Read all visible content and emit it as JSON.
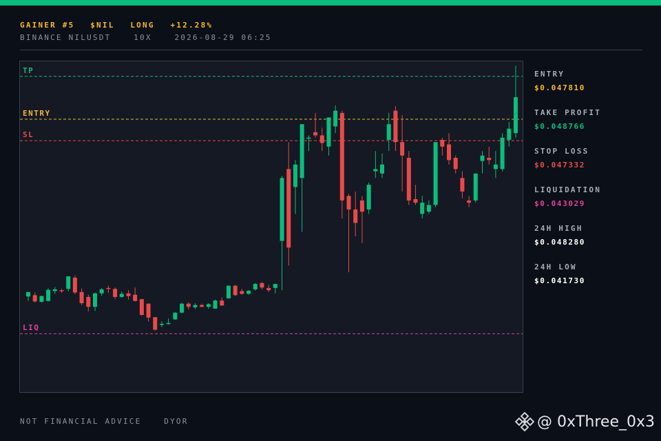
{
  "header": {
    "line1": [
      "GAINER #5",
      "$NIL",
      "LONG",
      "+12.28%"
    ],
    "line2": [
      "BINANCE NILUSDT",
      "10X",
      "2026-08-29 06:25"
    ]
  },
  "levels": {
    "tp": "TP",
    "entry": "ENTRY",
    "sl": "SL",
    "liq": "LIQ"
  },
  "stats": [
    {
      "label": "ENTRY",
      "value": "$0.047810",
      "color": "#f5b731"
    },
    {
      "label": "TAKE PROFIT",
      "value": "$0.048766",
      "color": "#0bbd7d"
    },
    {
      "label": "STOP LOSS",
      "value": "$0.047332",
      "color": "#e84a4a"
    },
    {
      "label": "LIQUIDATION",
      "value": "$0.043029",
      "color": "#e0409b"
    },
    {
      "label": "24H HIGH",
      "value": "$0.048280",
      "color": "#ffffff"
    },
    {
      "label": "24H LOW",
      "value": "$0.041730",
      "color": "#ffffff"
    }
  ],
  "footer": [
    "NOT FINANCIAL ADVICE",
    "DYOR"
  ],
  "watermark": {
    "icon": "binance-diamond-icon",
    "text": "@ 0xThree_0x3"
  },
  "colors": {
    "up": "#0bbd7d",
    "down": "#e84a4a",
    "tp": "#0bbd7d",
    "entry": "#f5b731",
    "sl": "#e84a4a",
    "liq": "#e0409b",
    "accent": "#0bbd7d"
  },
  "chart_data": {
    "type": "candlestick",
    "ylim": [
      0.0417,
      0.0491
    ],
    "hlines": [
      {
        "name": "TP",
        "value": 0.048766
      },
      {
        "name": "ENTRY",
        "value": 0.04781
      },
      {
        "name": "SL",
        "value": 0.047332
      },
      {
        "name": "LIQ",
        "value": 0.043029
      }
    ],
    "candles": [
      [
        0.04386,
        0.04396,
        0.04376,
        0.04396
      ],
      [
        0.04389,
        0.04395,
        0.04373,
        0.04375
      ],
      [
        0.04374,
        0.04388,
        0.04373,
        0.04387
      ],
      [
        0.04376,
        0.04404,
        0.04375,
        0.04401
      ],
      [
        0.04398,
        0.04407,
        0.04392,
        0.04402
      ],
      [
        0.044,
        0.04403,
        0.04394,
        0.04398
      ],
      [
        0.04403,
        0.04431,
        0.04397,
        0.04431
      ],
      [
        0.04428,
        0.04433,
        0.04391,
        0.04395
      ],
      [
        0.04396,
        0.04404,
        0.04367,
        0.04371
      ],
      [
        0.04385,
        0.0439,
        0.04353,
        0.04363
      ],
      [
        0.04363,
        0.04395,
        0.04354,
        0.04393
      ],
      [
        0.04393,
        0.04405,
        0.04387,
        0.04402
      ],
      [
        0.04405,
        0.0441,
        0.04394,
        0.04404
      ],
      [
        0.04403,
        0.04406,
        0.0438,
        0.04385
      ],
      [
        0.04385,
        0.04397,
        0.04383,
        0.04392
      ],
      [
        0.04393,
        0.044,
        0.04379,
        0.04387
      ],
      [
        0.0439,
        0.04406,
        0.04375,
        0.04376
      ],
      [
        0.0438,
        0.04381,
        0.04343,
        0.04345
      ],
      [
        0.0437,
        0.04371,
        0.0433,
        0.04339
      ],
      [
        0.0434,
        0.04328,
        0.0431,
        0.04312
      ],
      [
        0.04325,
        0.04331,
        0.04318,
        0.04325
      ],
      [
        0.04325,
        0.04337,
        0.04323,
        0.04327
      ],
      [
        0.04335,
        0.04351,
        0.04334,
        0.0435
      ],
      [
        0.0435,
        0.04372,
        0.04349,
        0.0437
      ],
      [
        0.0437,
        0.04373,
        0.04357,
        0.04363
      ],
      [
        0.04362,
        0.04371,
        0.04358,
        0.04367
      ],
      [
        0.04367,
        0.0437,
        0.04362,
        0.04363
      ],
      [
        0.04363,
        0.04371,
        0.04359,
        0.04369
      ],
      [
        0.04359,
        0.04379,
        0.04359,
        0.04377
      ],
      [
        0.04377,
        0.04384,
        0.04365,
        0.04366
      ],
      [
        0.04382,
        0.04411,
        0.04381,
        0.0441
      ],
      [
        0.0441,
        0.04412,
        0.04387,
        0.04389
      ],
      [
        0.04398,
        0.04403,
        0.0439,
        0.04392
      ],
      [
        0.04392,
        0.044,
        0.0439,
        0.04399
      ],
      [
        0.04402,
        0.04416,
        0.04399,
        0.04414
      ],
      [
        0.04416,
        0.04418,
        0.04402,
        0.04406
      ],
      [
        0.04405,
        0.04412,
        0.04396,
        0.044
      ],
      [
        0.04405,
        0.04413,
        0.04393,
        0.04414
      ],
      [
        0.0451,
        0.04655,
        0.044,
        0.0465
      ],
      [
        0.0467,
        0.0473,
        0.04455,
        0.04495
      ],
      [
        0.0463,
        0.0469,
        0.0457,
        0.0468
      ],
      [
        0.0465,
        0.04765,
        0.0453,
        0.0477
      ],
      [
        0.0474,
        0.04745,
        0.0471,
        0.0474
      ],
      [
        0.04752,
        0.04795,
        0.0474,
        0.04745
      ],
      [
        0.04745,
        0.04762,
        0.0471,
        0.04728
      ],
      [
        0.0472,
        0.04772,
        0.047,
        0.04785
      ],
      [
        0.04765,
        0.04812,
        0.0475,
        0.048
      ],
      [
        0.04795,
        0.048,
        0.0456,
        0.046
      ],
      [
        0.0461,
        0.04615,
        0.0444,
        0.0458
      ],
      [
        0.0458,
        0.0462,
        0.0452,
        0.0455
      ],
      [
        0.046,
        0.0461,
        0.04505,
        0.04575
      ],
      [
        0.0458,
        0.0464,
        0.0457,
        0.04635
      ],
      [
        0.04665,
        0.0471,
        0.0465,
        0.0467
      ],
      [
        0.0466,
        0.04705,
        0.0465,
        0.0468
      ],
      [
        0.04735,
        0.04795,
        0.0471,
        0.0477
      ],
      [
        0.048,
        0.0481,
        0.0471,
        0.0473
      ],
      [
        0.0473,
        0.0479,
        0.0462,
        0.047
      ],
      [
        0.04695,
        0.0471,
        0.0459,
        0.046
      ],
      [
        0.04603,
        0.04635,
        0.0459,
        0.04595
      ],
      [
        0.0457,
        0.0461,
        0.0456,
        0.04595
      ],
      [
        0.04575,
        0.046,
        0.0457,
        0.0459
      ],
      [
        0.0459,
        0.0465,
        0.04585,
        0.0473
      ],
      [
        0.04735,
        0.0474,
        0.047,
        0.0472
      ],
      [
        0.04725,
        0.0475,
        0.0468,
        0.0469
      ],
      [
        0.04695,
        0.047,
        0.0466,
        0.0467
      ],
      [
        0.0465,
        0.04665,
        0.04605,
        0.0462
      ],
      [
        0.046,
        0.0461,
        0.04585,
        0.04595
      ],
      [
        0.046,
        0.0466,
        0.04595,
        0.0466
      ],
      [
        0.04688,
        0.0471,
        0.0466,
        0.047
      ],
      [
        0.04695,
        0.0472,
        0.0468,
        0.0469
      ],
      [
        0.0467,
        0.0471,
        0.0465,
        0.0468
      ],
      [
        0.0467,
        0.0475,
        0.04665,
        0.0474
      ],
      [
        0.04735,
        0.04775,
        0.0472,
        0.0476
      ],
      [
        0.0475,
        0.049,
        0.0474,
        0.0483
      ]
    ]
  }
}
